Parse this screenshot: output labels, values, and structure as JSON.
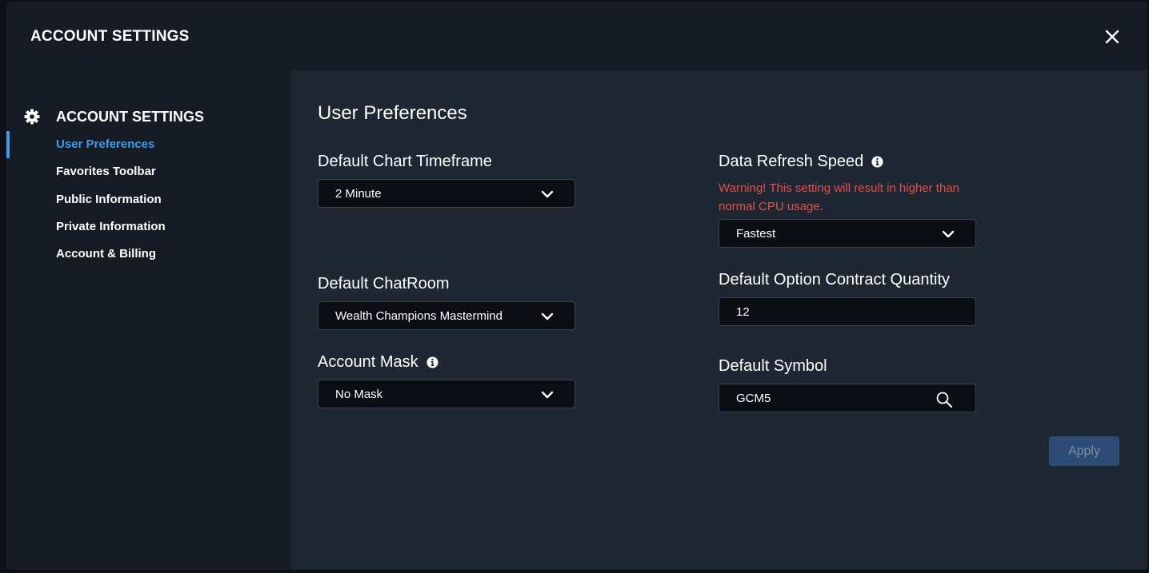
{
  "modal": {
    "title": "ACCOUNT SETTINGS"
  },
  "sidebar": {
    "title": "ACCOUNT SETTINGS",
    "items": [
      {
        "label": "User Preferences",
        "active": true
      },
      {
        "label": "Favorites Toolbar",
        "active": false
      },
      {
        "label": "Public Information",
        "active": false
      },
      {
        "label": "Private Information",
        "active": false
      },
      {
        "label": "Account & Billing",
        "active": false
      }
    ]
  },
  "preferences": {
    "title": "User Preferences",
    "chart_timeframe": {
      "label": "Default Chart Timeframe",
      "value": "2 Minute"
    },
    "chatroom": {
      "label": "Default ChatRoom",
      "value": "Wealth Champions Mastermind"
    },
    "account_mask": {
      "label": "Account Mask",
      "value": "No Mask"
    },
    "refresh_speed": {
      "label": "Data Refresh Speed",
      "warning": "Warning! This setting will result in higher than normal CPU usage.",
      "value": "Fastest"
    },
    "option_quantity": {
      "label": "Default Option Contract Quantity",
      "value": "12"
    },
    "default_symbol": {
      "label": "Default Symbol",
      "value": "GCM5"
    },
    "apply_label": "Apply"
  },
  "colors": {
    "accent": "#3d9bf0",
    "warning": "#e0504a",
    "apply_bg": "#2c4b75"
  }
}
